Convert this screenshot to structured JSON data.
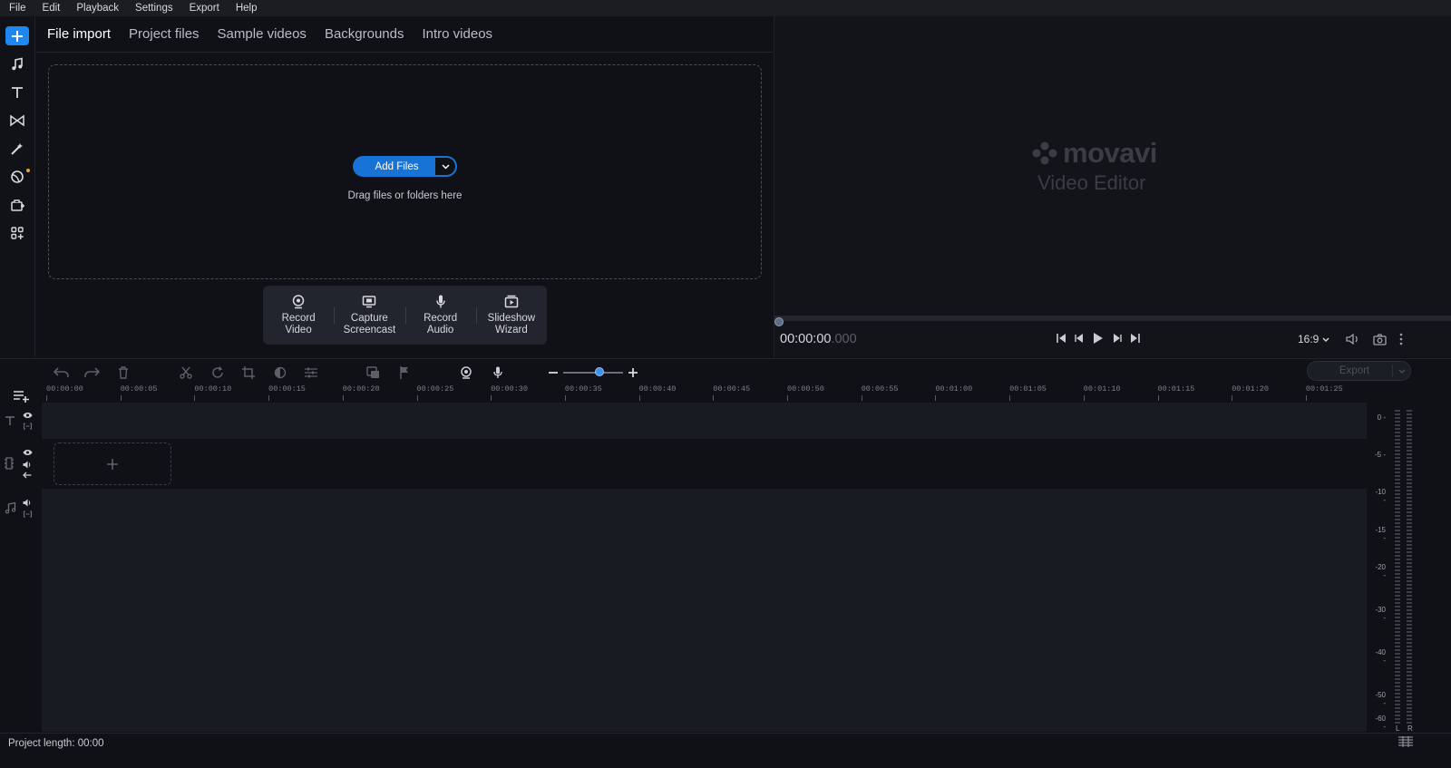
{
  "menu": [
    "File",
    "Edit",
    "Playback",
    "Settings",
    "Export",
    "Help"
  ],
  "tabs": [
    "File import",
    "Project files",
    "Sample videos",
    "Backgrounds",
    "Intro videos"
  ],
  "import": {
    "add_files_label": "Add Files",
    "drag_text": "Drag files or folders here",
    "record_buttons": [
      {
        "line1": "Record",
        "line2": "Video",
        "icon": "webcam-icon"
      },
      {
        "line1": "Capture",
        "line2": "Screencast",
        "icon": "screen-icon"
      },
      {
        "line1": "Record",
        "line2": "Audio",
        "icon": "microphone-icon"
      },
      {
        "line1": "Slideshow",
        "line2": "Wizard",
        "icon": "slideshow-icon"
      }
    ]
  },
  "preview": {
    "brand": "movavi",
    "product": "Video Editor",
    "timecode_main": "00:00:00",
    "timecode_ms": ".000",
    "aspect": "16:9"
  },
  "toolbar": {
    "export_label": "Export"
  },
  "ruler": [
    "00:00:00",
    "00:00:05",
    "00:00:10",
    "00:00:15",
    "00:00:20",
    "00:00:25",
    "00:00:30",
    "00:00:35",
    "00:00:40",
    "00:00:45",
    "00:00:50",
    "00:00:55",
    "00:01:00",
    "00:01:05",
    "00:01:10",
    "00:01:15",
    "00:01:20",
    "00:01:25"
  ],
  "meter": {
    "db_labels": [
      "0",
      "-5",
      "-10",
      "-15",
      "-20",
      "-30",
      "-40",
      "-50",
      "-60"
    ],
    "channels": [
      "L",
      "R"
    ]
  },
  "status": {
    "project_length": "Project length: 00:00"
  },
  "colors": {
    "accent": "#1e88f0",
    "background": "#0f1116",
    "track": "#181b22"
  }
}
